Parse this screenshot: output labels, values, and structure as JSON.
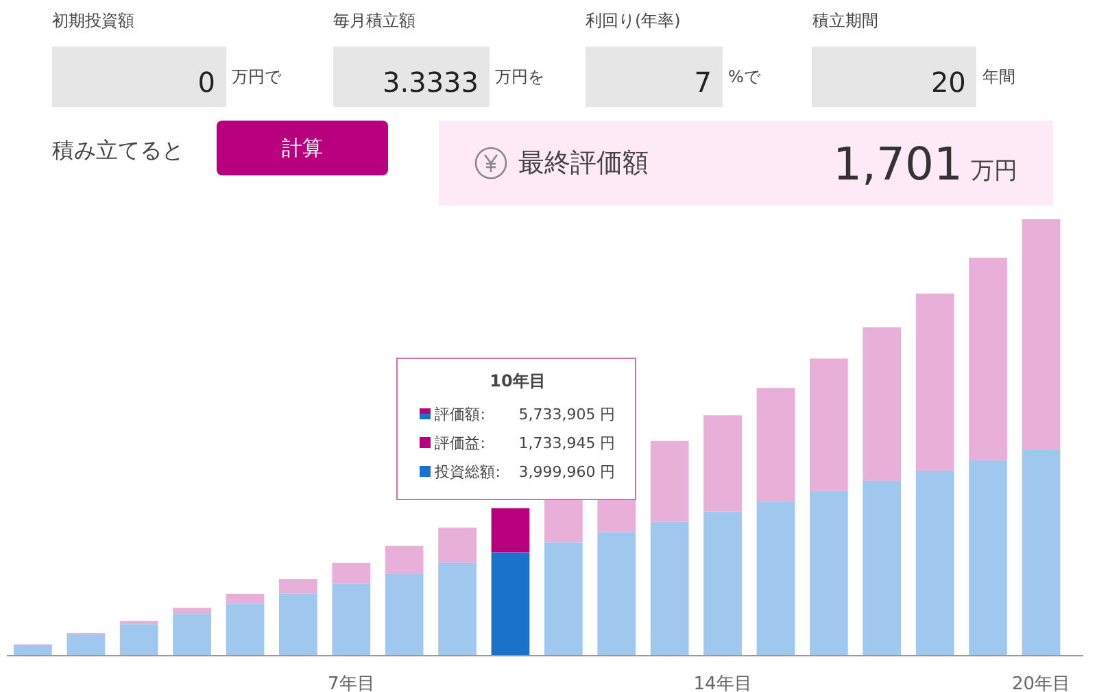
{
  "inputs": [
    {
      "label": "初期投資額",
      "value": "0",
      "unit": "万円で"
    },
    {
      "label": "毎月積立額",
      "value": "3.3333",
      "unit": "万円を"
    },
    {
      "label": "利回り(年率)",
      "value": "7",
      "unit": "%で"
    },
    {
      "label": "積立期間",
      "value": "20",
      "unit": "年間"
    }
  ],
  "action": {
    "prefix": "積み立てると",
    "button": "計算"
  },
  "result": {
    "label": "最終評価額",
    "value": "1,701",
    "unit": "万円"
  },
  "chart": {
    "bars": [
      {
        "selected": false
      },
      {
        "selected": false
      },
      {
        "selected": false
      },
      {
        "selected": false
      },
      {
        "selected": false
      },
      {
        "selected": false
      },
      {
        "selected": false,
        "label": "7年目"
      },
      {
        "selected": false
      },
      {
        "selected": false
      },
      {
        "selected": true
      },
      {
        "selected": false
      },
      {
        "selected": false
      },
      {
        "selected": false
      },
      {
        "selected": false,
        "label": "14年目"
      },
      {
        "selected": false
      },
      {
        "selected": false
      },
      {
        "selected": false
      },
      {
        "selected": false
      },
      {
        "selected": false
      },
      {
        "selected": false,
        "label": "20年目"
      }
    ],
    "tooltip": {
      "title": "10年目",
      "rows": [
        {
          "kind": "value",
          "label": "評価額:",
          "value": "5,733,905 円"
        },
        {
          "kind": "gain",
          "label": "評価益:",
          "value": "1,733,945 円"
        },
        {
          "kind": "invested",
          "label": "投資総額:",
          "value": "3,999,960 円"
        }
      ]
    }
  }
}
